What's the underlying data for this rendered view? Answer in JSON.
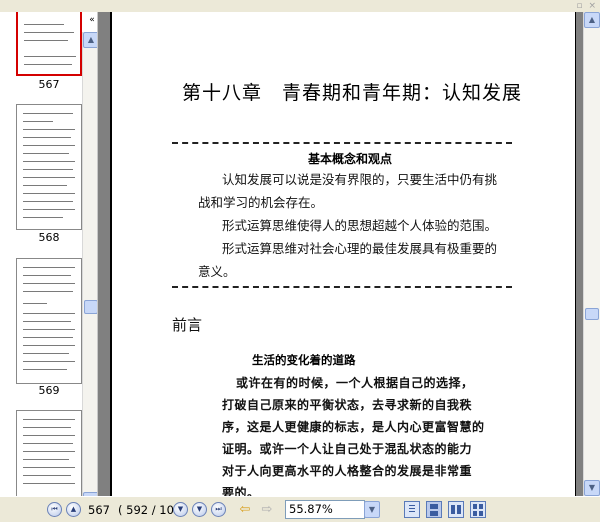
{
  "window": {
    "controls": [
      "▫",
      "×"
    ]
  },
  "thumbnails": {
    "collapse_icon": "«",
    "items": [
      {
        "label": "567",
        "selected": true
      },
      {
        "label": "568",
        "selected": false
      },
      {
        "label": "569",
        "selected": false
      },
      {
        "label": "",
        "selected": false
      }
    ]
  },
  "document": {
    "chapter_title": "第十八章　青春期和青年期：认知发展",
    "box": {
      "title": "基本概念和观点",
      "lines": [
        "认知发展可以说是没有界限的，只要生活中仍有挑",
        "战和学习的机会存在。",
        "形式运算思维使得人的思想超越个人体验的范围。",
        "形式运算思维对社会心理的最佳发展具有极重要的",
        "意义。"
      ]
    },
    "section_heading": "前言",
    "subheading": "生活的变化着的道路",
    "body_lines": [
      "或许在有的时候，一个人根据自己的选择，",
      "打破自己原来的平衡状态，去寻求新的自我秩",
      "序，这是人更健康的标志，是人内心更富智慧的",
      "证明。或许一个人让自己处于混乱状态的能力",
      "对于人向更高水平的人格整合的发展是非常重",
      "要的。"
    ]
  },
  "toolbar": {
    "current_page": "567",
    "page_info": "( 592 / 10",
    "zoom": "55.87%"
  },
  "icons": {
    "first": "⏮",
    "prev": "▲",
    "next": "▼",
    "last": "⏭",
    "back": "⇦",
    "forward": "⇨",
    "dropdown": "▼",
    "up": "▲",
    "down": "▼"
  }
}
